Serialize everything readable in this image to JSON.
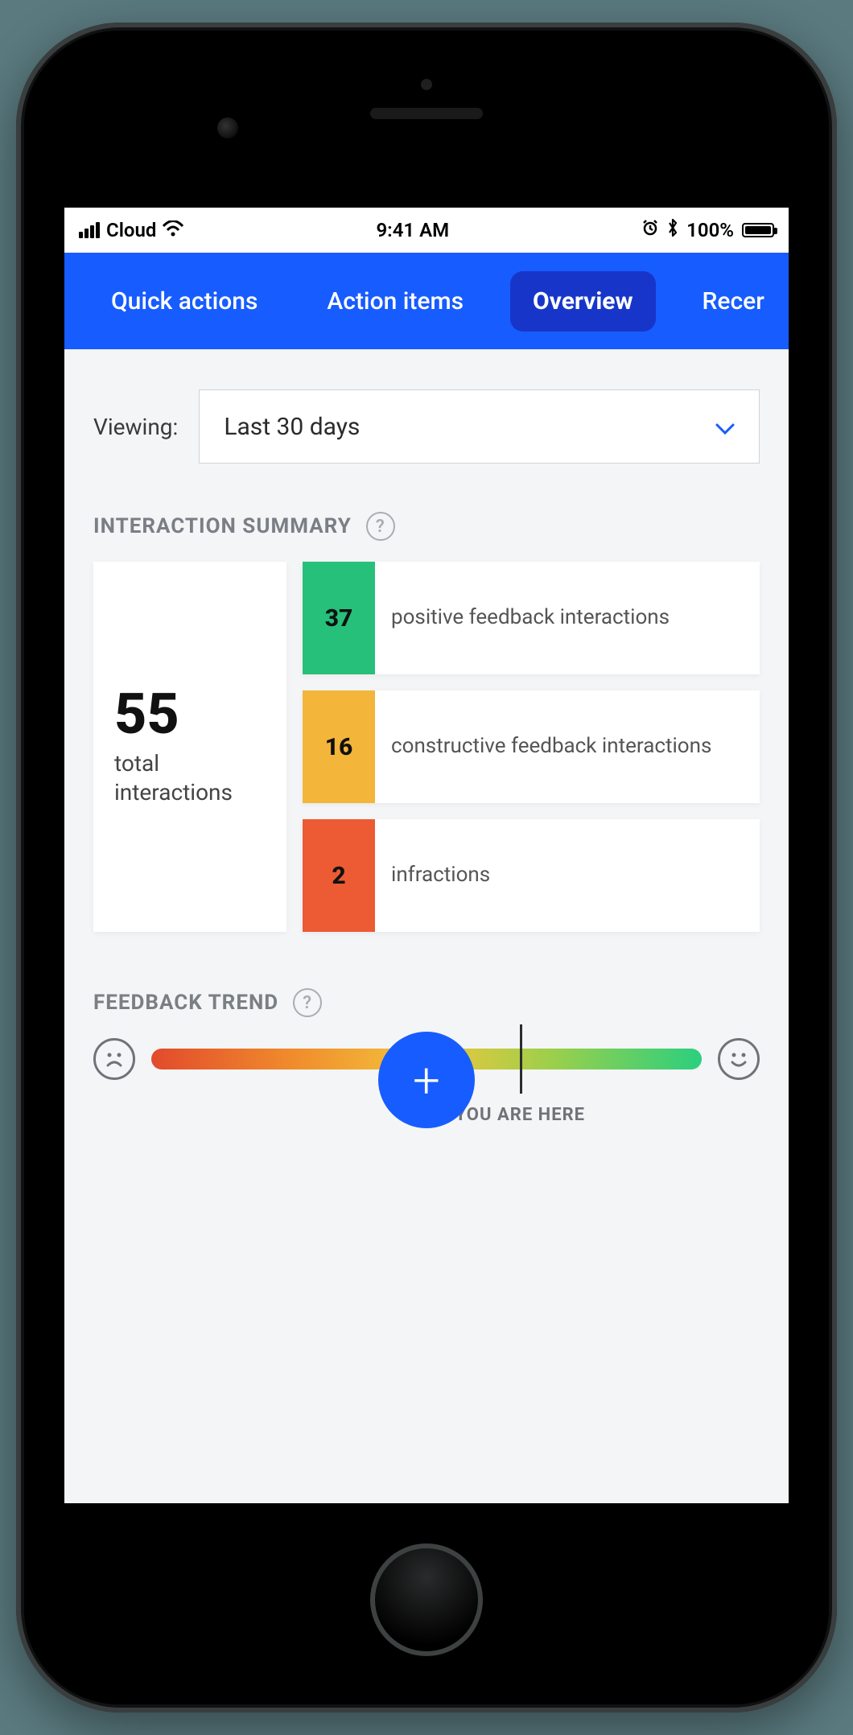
{
  "status_bar": {
    "carrier": "Cloud",
    "time": "9:41 AM",
    "battery_pct": "100%"
  },
  "tabs": {
    "items": [
      {
        "label": "Quick actions"
      },
      {
        "label": "Action items"
      },
      {
        "label": "Overview"
      },
      {
        "label": "Recer"
      }
    ],
    "active_index": 2
  },
  "viewing": {
    "label": "Viewing:",
    "selected": "Last 30 days"
  },
  "interaction_summary": {
    "heading": "INTERACTION SUMMARY",
    "total_value": "55",
    "total_label": "total interactions",
    "stats": [
      {
        "value": "37",
        "label": "positive feedback interactions",
        "color": "#27c07a"
      },
      {
        "value": "16",
        "label": "constructive feedback interactions",
        "color": "#f3b53a"
      },
      {
        "value": "2",
        "label": "infractions",
        "color": "#ec5b33"
      }
    ]
  },
  "feedback_trend": {
    "heading": "FEEDBACK TREND",
    "position_pct": 67,
    "here_label": "YOU ARE HERE"
  },
  "fab": {
    "label": "+"
  },
  "chart_data": {
    "type": "bar",
    "title": "Interaction Summary (Last 30 days)",
    "categories": [
      "positive feedback interactions",
      "constructive feedback interactions",
      "infractions"
    ],
    "values": [
      37,
      16,
      2
    ],
    "total": 55,
    "colors": [
      "#27c07a",
      "#f3b53a",
      "#ec5b33"
    ]
  }
}
